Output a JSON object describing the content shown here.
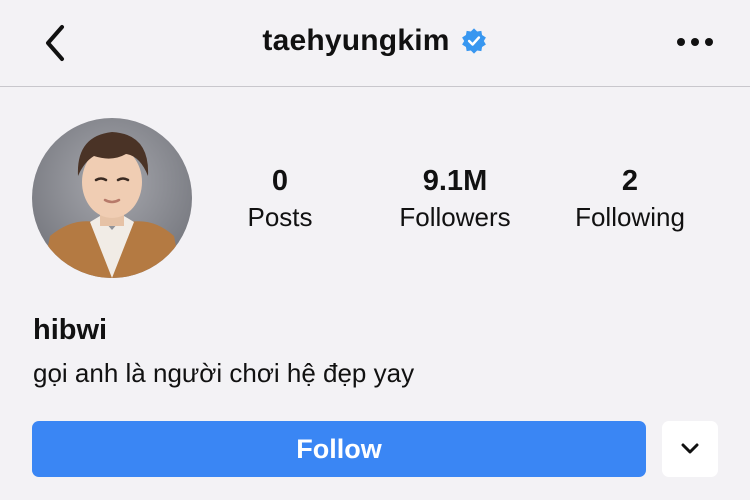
{
  "header": {
    "back_icon": "chevron-left-icon",
    "username": "taehyungkim",
    "verified_icon": "verified-badge-icon",
    "more_icon": "more-horizontal-icon"
  },
  "profile": {
    "avatar": "profile-photo",
    "stats": {
      "posts": {
        "value": "0",
        "label": "Posts"
      },
      "followers": {
        "value": "9.1M",
        "label": "Followers"
      },
      "following": {
        "value": "2",
        "label": "Following"
      }
    },
    "name": "hibwi",
    "bio": "gọi anh là người chơi hệ đẹp yay"
  },
  "actions": {
    "follow_label": "Follow",
    "dropdown_icon": "chevron-down-icon"
  },
  "colors": {
    "accent": "#3a86f4",
    "background": "#f3f2f5",
    "verified": "#3897f0"
  }
}
